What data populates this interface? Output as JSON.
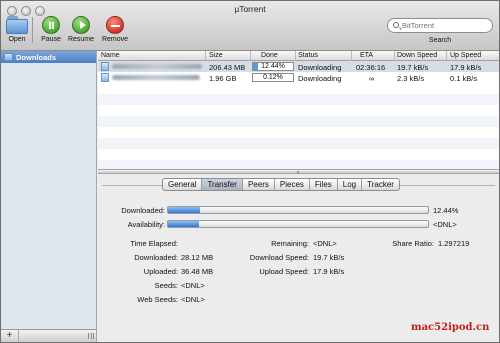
{
  "window": {
    "title": "µTorrent"
  },
  "toolbar": {
    "open_label": "Open",
    "pause_label": "Pause",
    "resume_label": "Resume",
    "remove_label": "Remove"
  },
  "search": {
    "placeholder": "BitTorrent",
    "label": "Search"
  },
  "sidebar": {
    "items": [
      {
        "label": "Downloads",
        "selected": true
      }
    ],
    "add_label": "+"
  },
  "list": {
    "columns": [
      "Name",
      "Size",
      "Done",
      "Status",
      "ETA",
      "Down Speed",
      "Up Speed"
    ],
    "rows": [
      {
        "size": "206.43 MB",
        "done": "12.44%",
        "status": "Downloading",
        "eta": "02:36:16",
        "down": "19.7 kB/s",
        "up": "17.9 kB/s",
        "selected": true
      },
      {
        "size": "1.96 GB",
        "done": "0.12%",
        "status": "Downloading",
        "eta": "∞",
        "down": "2.3 kB/s",
        "up": "0.1 kB/s",
        "selected": false
      }
    ]
  },
  "detail": {
    "tabs": [
      "General",
      "Transfer",
      "Peers",
      "Pieces",
      "Files",
      "Log",
      "Tracker"
    ],
    "active_tab": "Transfer",
    "downloaded_label": "Downloaded:",
    "downloaded_pct": "12.44%",
    "downloaded_fraction": 0.1244,
    "availability_label": "Availability:",
    "availability_value": "<DNL>",
    "availability_fraction": 0.12,
    "stats": {
      "time_elapsed_label": "Time Elapsed:",
      "time_elapsed_value": "",
      "downloaded_label": "Downloaded:",
      "downloaded_value": "28.12 MB",
      "uploaded_label": "Uploaded:",
      "uploaded_value": "36.48 MB",
      "seeds_label": "Seeds:",
      "seeds_value": "<DNL>",
      "web_seeds_label": "Web Seeds:",
      "web_seeds_value": "<DNL>",
      "remaining_label": "Remaining:",
      "remaining_value": "<DNL>",
      "download_speed_label": "Download Speed:",
      "download_speed_value": "19.7 kB/s",
      "upload_speed_label": "Upload Speed:",
      "upload_speed_value": "17.9 kB/s",
      "share_ratio_label": "Share Ratio:",
      "share_ratio_value": "1.297219"
    }
  },
  "watermark": "mac52ipod.cn",
  "colors": {
    "selection": "#d6dde6",
    "sidebar_selected": "#5d8dcf",
    "progress": "#2f76d6",
    "remove_red": "#c4140c",
    "play_green": "#2f8f1b"
  }
}
